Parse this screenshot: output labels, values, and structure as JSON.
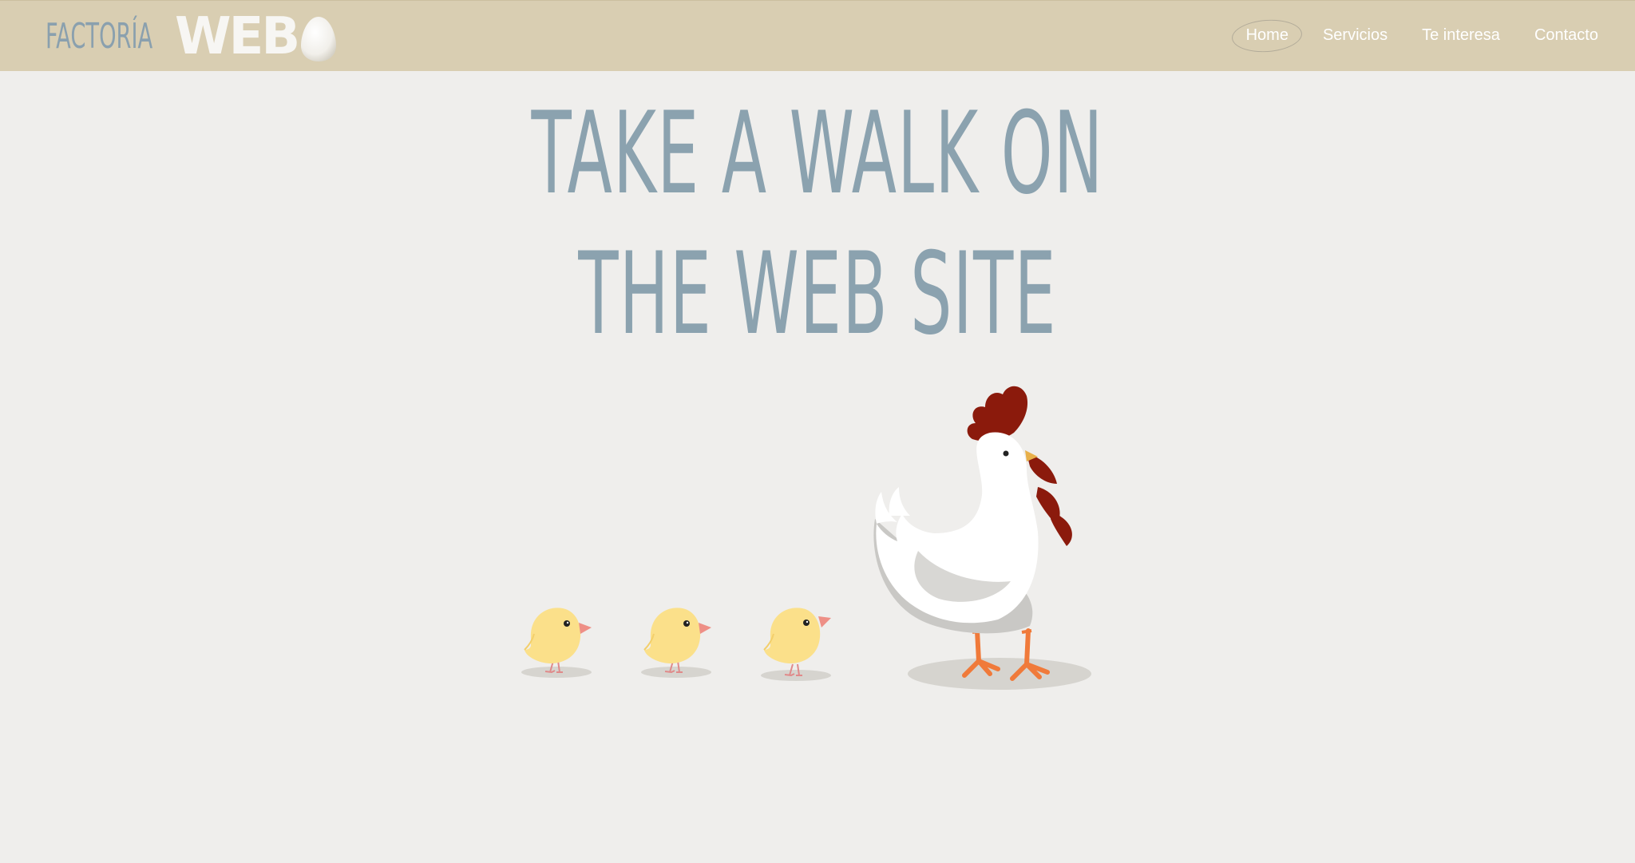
{
  "logo": {
    "factoria": "FACTORÍA",
    "web": "WEB"
  },
  "nav": {
    "items": [
      {
        "label": "Home",
        "active": true
      },
      {
        "label": "Servicios",
        "active": false
      },
      {
        "label": "Te interesa",
        "active": false
      },
      {
        "label": "Contacto",
        "active": false
      }
    ]
  },
  "hero": {
    "line1": "TAKE A WALK ON",
    "line2": "THE WEB SITE"
  },
  "illustration": {
    "icons": [
      "chick-icon",
      "chick-icon",
      "chick-icon",
      "hen-icon"
    ]
  },
  "colors": {
    "header_bg": "#d9ceb2",
    "page_bg": "#efeeec",
    "hero_text": "#8ba2af",
    "nav_text": "#ffffff",
    "chick": "#fbe08a",
    "comb": "#8b1a0c",
    "feet": "#f07a3a"
  }
}
